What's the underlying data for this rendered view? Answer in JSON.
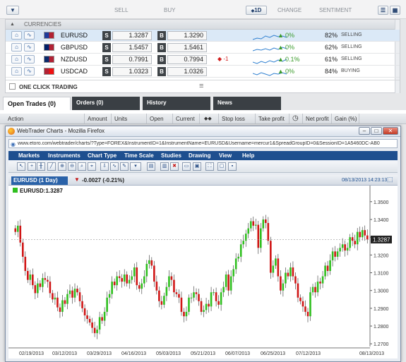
{
  "header": {
    "filter_icon": "filter-icon",
    "sell_label": "SELL",
    "buy_label": "BUY",
    "period_button": "1D",
    "change_label": "CHANGE",
    "sentiment_label": "SENTIMENT"
  },
  "currencies": {
    "title": "CURRENCIES",
    "rows": [
      {
        "symbol": "EURUSD",
        "sell": "1.3287",
        "buy": "1.3290",
        "delta": "",
        "change": "0%",
        "sentiment": "82%",
        "sentiment_label": "SELLING",
        "flag": "eu-us"
      },
      {
        "symbol": "GBPUSD",
        "sell": "1.5457",
        "buy": "1.5461",
        "delta": "",
        "change": "0%",
        "sentiment": "62%",
        "sentiment_label": "SELLING",
        "flag": "gb-us"
      },
      {
        "symbol": "NZDUSD",
        "sell": "0.7991",
        "buy": "0.7994",
        "delta": "-1",
        "change": "0.1%",
        "sentiment": "61%",
        "sentiment_label": "SELLING",
        "flag": "nz-us"
      },
      {
        "symbol": "USDCAD",
        "sell": "1.0323",
        "buy": "1.0326",
        "delta": "",
        "change": "0%",
        "sentiment": "84%",
        "sentiment_label": "BUYING",
        "flag": "us-ca"
      }
    ],
    "sell_letter": "S",
    "buy_letter": "B",
    "one_click": "ONE CLICK TRADING"
  },
  "tabs": [
    {
      "label": "Open Trades (0)",
      "active": true
    },
    {
      "label": "Orders (0)",
      "active": false
    },
    {
      "label": "History",
      "active": false
    },
    {
      "label": "News",
      "active": false
    }
  ],
  "columns": [
    "Action",
    "Amount",
    "Units",
    "Open",
    "Current",
    "Stop loss",
    "Take profit",
    "Net profit",
    "Gain (%)"
  ],
  "browser": {
    "title": "WebTrader Charts - Mozilla Firefox",
    "url": "www.etoro.com/webtrader/charts/?Type=FOREX&InstrumentID=1&InstrumentName=EURUSD&Username=mercur1&SpreadGroupID=0&SessionID=1A5460DC-AB0",
    "menu": [
      "Markets",
      "Instruments",
      "Chart Type",
      "Time Scale",
      "Studies",
      "Drawing",
      "View",
      "Help"
    ]
  },
  "chart_header": {
    "tab_label": "EURUSD (1 Day)",
    "change": "-0.0027 (-0.21%)",
    "timestamp": "08/13/2013 14:23:13",
    "legend": "EURUSD:1.3287",
    "last_price": "1.3287"
  },
  "chart_data": {
    "type": "candlestick",
    "x_labels": [
      "02/19/2013",
      "03/12/2013",
      "03/29/2013",
      "04/16/2013",
      "05/03/2013",
      "05/21/2013",
      "06/07/2013",
      "06/25/2013",
      "07/12/2013",
      "08/13/2013"
    ],
    "y_ticks": [
      1.27,
      1.28,
      1.29,
      1.3,
      1.31,
      1.32,
      1.33,
      1.34,
      1.35
    ],
    "ylim": [
      1.2685,
      1.3535
    ],
    "last_price": 1.3287,
    "up_color": "#2fbf1f",
    "down_color": "#d01616",
    "closes": [
      1.333,
      1.3365,
      1.327,
      1.319,
      1.311,
      1.306,
      1.309,
      1.303,
      1.2985,
      1.304,
      1.302,
      1.307,
      1.306,
      1.305,
      1.2985,
      1.295,
      1.296,
      1.2905,
      1.288,
      1.2945,
      1.2925,
      1.298,
      1.3,
      1.296,
      1.301,
      1.299,
      1.294,
      1.29,
      1.286,
      1.284,
      1.282,
      1.279,
      1.276,
      1.278,
      1.285,
      1.283,
      1.288,
      1.296,
      1.298,
      1.305,
      1.303,
      1.308,
      1.307,
      1.305,
      1.309,
      1.304,
      1.306,
      1.308,
      1.313,
      1.303,
      1.301,
      1.304,
      1.308,
      1.315,
      1.317,
      1.314,
      1.305,
      1.3,
      1.294,
      1.292,
      1.297,
      1.302,
      1.308,
      1.306,
      1.299,
      1.298,
      1.296,
      1.288,
      1.2855,
      1.288,
      1.296,
      1.296,
      1.299,
      1.298,
      1.294,
      1.288,
      1.289,
      1.2925,
      1.291,
      1.299,
      1.299,
      1.294,
      1.292,
      1.299,
      1.302,
      1.309,
      1.3,
      1.308,
      1.312,
      1.318,
      1.319,
      1.326,
      1.328,
      1.332,
      1.335,
      1.339,
      1.3365,
      1.337,
      1.324,
      1.335,
      1.34,
      1.338,
      1.328,
      1.31,
      1.314,
      1.318,
      1.308,
      1.3,
      1.304,
      1.31,
      1.308,
      1.313,
      1.308,
      1.304,
      1.296,
      1.294,
      1.291,
      1.288,
      1.2855,
      1.299,
      1.302,
      1.299,
      1.305,
      1.304,
      1.308,
      1.314,
      1.311,
      1.317,
      1.322,
      1.319,
      1.322,
      1.324,
      1.326,
      1.3225,
      1.324,
      1.33,
      1.328,
      1.326,
      1.333,
      1.33,
      1.334,
      1.331,
      1.3287
    ]
  },
  "colors": {
    "menu_bar": "#1e4f8f",
    "tab_dark": "#3a3f44",
    "positive": "#3a9b2b",
    "negative": "#d21e1e"
  }
}
